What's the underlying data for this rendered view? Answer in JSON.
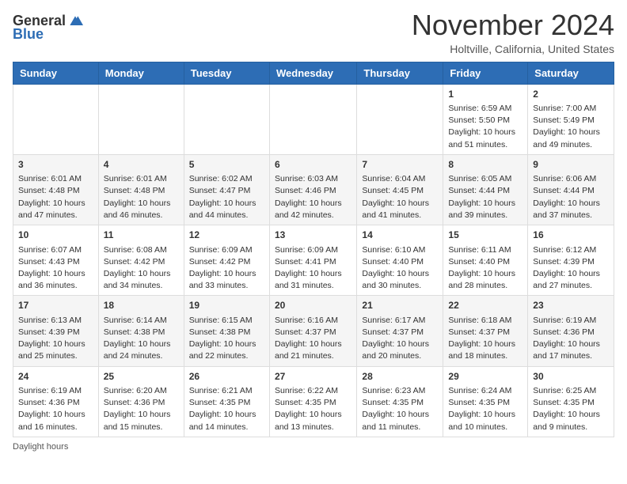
{
  "header": {
    "logo_general": "General",
    "logo_blue": "Blue",
    "month": "November 2024",
    "location": "Holtville, California, United States"
  },
  "days_of_week": [
    "Sunday",
    "Monday",
    "Tuesday",
    "Wednesday",
    "Thursday",
    "Friday",
    "Saturday"
  ],
  "weeks": [
    [
      {
        "day": "",
        "content": ""
      },
      {
        "day": "",
        "content": ""
      },
      {
        "day": "",
        "content": ""
      },
      {
        "day": "",
        "content": ""
      },
      {
        "day": "",
        "content": ""
      },
      {
        "day": "1",
        "content": "Sunrise: 6:59 AM\nSunset: 5:50 PM\nDaylight: 10 hours and 51 minutes."
      },
      {
        "day": "2",
        "content": "Sunrise: 7:00 AM\nSunset: 5:49 PM\nDaylight: 10 hours and 49 minutes."
      }
    ],
    [
      {
        "day": "3",
        "content": "Sunrise: 6:01 AM\nSunset: 4:48 PM\nDaylight: 10 hours and 47 minutes."
      },
      {
        "day": "4",
        "content": "Sunrise: 6:01 AM\nSunset: 4:48 PM\nDaylight: 10 hours and 46 minutes."
      },
      {
        "day": "5",
        "content": "Sunrise: 6:02 AM\nSunset: 4:47 PM\nDaylight: 10 hours and 44 minutes."
      },
      {
        "day": "6",
        "content": "Sunrise: 6:03 AM\nSunset: 4:46 PM\nDaylight: 10 hours and 42 minutes."
      },
      {
        "day": "7",
        "content": "Sunrise: 6:04 AM\nSunset: 4:45 PM\nDaylight: 10 hours and 41 minutes."
      },
      {
        "day": "8",
        "content": "Sunrise: 6:05 AM\nSunset: 4:44 PM\nDaylight: 10 hours and 39 minutes."
      },
      {
        "day": "9",
        "content": "Sunrise: 6:06 AM\nSunset: 4:44 PM\nDaylight: 10 hours and 37 minutes."
      }
    ],
    [
      {
        "day": "10",
        "content": "Sunrise: 6:07 AM\nSunset: 4:43 PM\nDaylight: 10 hours and 36 minutes."
      },
      {
        "day": "11",
        "content": "Sunrise: 6:08 AM\nSunset: 4:42 PM\nDaylight: 10 hours and 34 minutes."
      },
      {
        "day": "12",
        "content": "Sunrise: 6:09 AM\nSunset: 4:42 PM\nDaylight: 10 hours and 33 minutes."
      },
      {
        "day": "13",
        "content": "Sunrise: 6:09 AM\nSunset: 4:41 PM\nDaylight: 10 hours and 31 minutes."
      },
      {
        "day": "14",
        "content": "Sunrise: 6:10 AM\nSunset: 4:40 PM\nDaylight: 10 hours and 30 minutes."
      },
      {
        "day": "15",
        "content": "Sunrise: 6:11 AM\nSunset: 4:40 PM\nDaylight: 10 hours and 28 minutes."
      },
      {
        "day": "16",
        "content": "Sunrise: 6:12 AM\nSunset: 4:39 PM\nDaylight: 10 hours and 27 minutes."
      }
    ],
    [
      {
        "day": "17",
        "content": "Sunrise: 6:13 AM\nSunset: 4:39 PM\nDaylight: 10 hours and 25 minutes."
      },
      {
        "day": "18",
        "content": "Sunrise: 6:14 AM\nSunset: 4:38 PM\nDaylight: 10 hours and 24 minutes."
      },
      {
        "day": "19",
        "content": "Sunrise: 6:15 AM\nSunset: 4:38 PM\nDaylight: 10 hours and 22 minutes."
      },
      {
        "day": "20",
        "content": "Sunrise: 6:16 AM\nSunset: 4:37 PM\nDaylight: 10 hours and 21 minutes."
      },
      {
        "day": "21",
        "content": "Sunrise: 6:17 AM\nSunset: 4:37 PM\nDaylight: 10 hours and 20 minutes."
      },
      {
        "day": "22",
        "content": "Sunrise: 6:18 AM\nSunset: 4:37 PM\nDaylight: 10 hours and 18 minutes."
      },
      {
        "day": "23",
        "content": "Sunrise: 6:19 AM\nSunset: 4:36 PM\nDaylight: 10 hours and 17 minutes."
      }
    ],
    [
      {
        "day": "24",
        "content": "Sunrise: 6:19 AM\nSunset: 4:36 PM\nDaylight: 10 hours and 16 minutes."
      },
      {
        "day": "25",
        "content": "Sunrise: 6:20 AM\nSunset: 4:36 PM\nDaylight: 10 hours and 15 minutes."
      },
      {
        "day": "26",
        "content": "Sunrise: 6:21 AM\nSunset: 4:35 PM\nDaylight: 10 hours and 14 minutes."
      },
      {
        "day": "27",
        "content": "Sunrise: 6:22 AM\nSunset: 4:35 PM\nDaylight: 10 hours and 13 minutes."
      },
      {
        "day": "28",
        "content": "Sunrise: 6:23 AM\nSunset: 4:35 PM\nDaylight: 10 hours and 11 minutes."
      },
      {
        "day": "29",
        "content": "Sunrise: 6:24 AM\nSunset: 4:35 PM\nDaylight: 10 hours and 10 minutes."
      },
      {
        "day": "30",
        "content": "Sunrise: 6:25 AM\nSunset: 4:35 PM\nDaylight: 10 hours and 9 minutes."
      }
    ]
  ],
  "footer": {
    "daylight_label": "Daylight hours"
  },
  "accent_color": "#2d6db5"
}
